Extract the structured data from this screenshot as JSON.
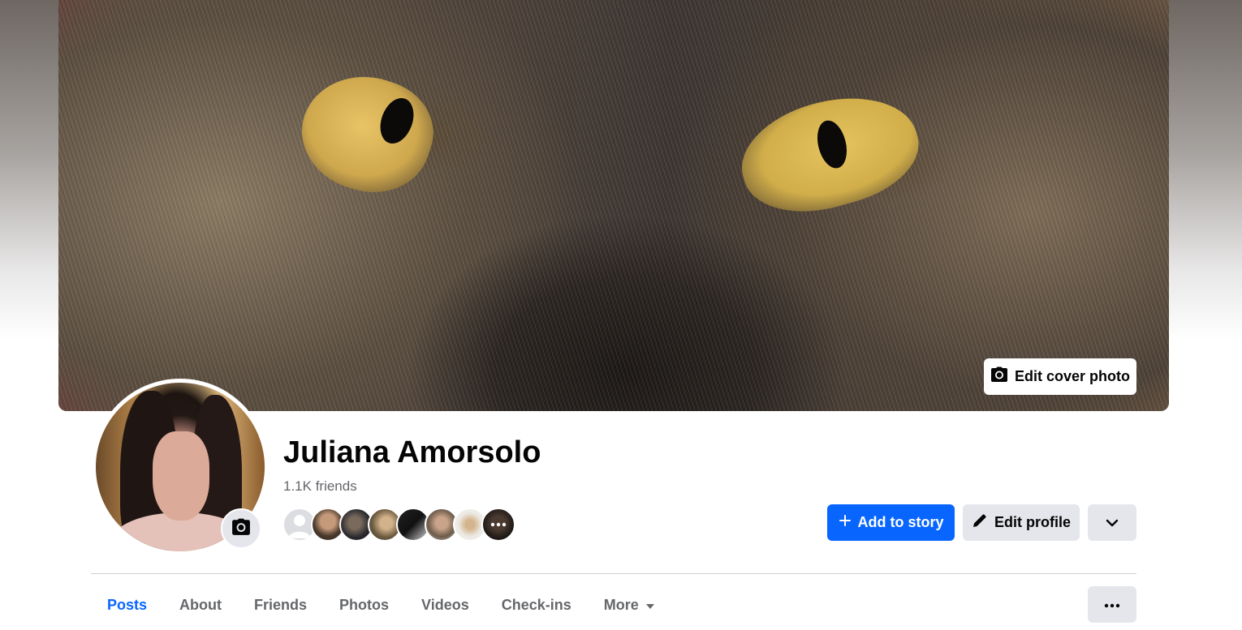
{
  "profile": {
    "name": "Juliana Amorsolo",
    "friends_count": "1.1K friends"
  },
  "cover": {
    "edit_label": "Edit cover photo"
  },
  "actions": {
    "add_story_label": "Add to story",
    "edit_profile_label": "Edit profile",
    "more_icon": "chevron-down-icon"
  },
  "tabs": [
    {
      "label": "Posts",
      "active": true
    },
    {
      "label": "About"
    },
    {
      "label": "Friends"
    },
    {
      "label": "Photos"
    },
    {
      "label": "Videos"
    },
    {
      "label": "Check-ins"
    },
    {
      "label": "More"
    }
  ],
  "colors": {
    "accent": "#0866ff",
    "secondary_button": "#e4e6eb",
    "muted_text": "#65676b"
  },
  "icons": {
    "cover_camera": "camera-icon",
    "avatar_camera": "camera-icon",
    "story_plus": "plus-icon",
    "edit_pencil": "pencil-icon",
    "tabs_overflow": "ellipsis-icon"
  }
}
